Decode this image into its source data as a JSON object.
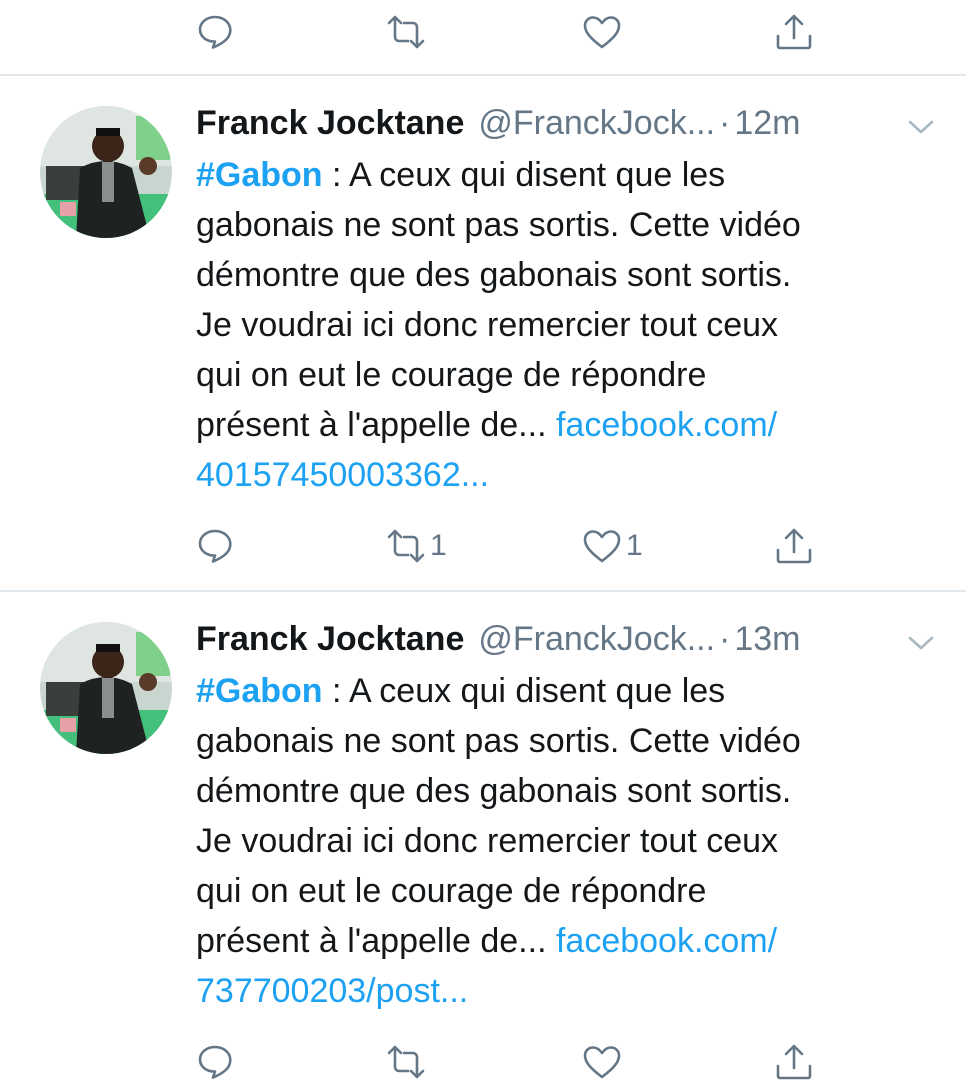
{
  "top_actions": {
    "reply_icon": "reply-icon",
    "retweet_icon": "retweet-icon",
    "like_icon": "like-icon",
    "share_icon": "share-icon"
  },
  "tweets": [
    {
      "name": "Franck Jocktane",
      "handle": "@FranckJock...",
      "separator": "·",
      "time": "12m",
      "hashtag": "#Gabon",
      "line1_rest": " : A ceux qui disent que les",
      "line2": "gabonais ne sont pas sortis. Cette vidéo",
      "line3": "démontre que des gabonais sont sortis.",
      "line4": "Je voudrai ici donc remercier tout ceux",
      "line5": "qui on eut le courage de répondre",
      "line6_text": "présent à l'appelle de... ",
      "line6_link": "facebook.com/",
      "line7_link": "40157450003362...",
      "retweet_count": "1",
      "like_count": "1"
    },
    {
      "name": "Franck Jocktane",
      "handle": "@FranckJock...",
      "separator": "·",
      "time": "13m",
      "hashtag": "#Gabon",
      "line1_rest": " : A ceux qui disent que les",
      "line2": "gabonais ne sont pas sortis. Cette vidéo",
      "line3": "démontre que des gabonais sont sortis.",
      "line4": "Je voudrai ici donc remercier tout ceux",
      "line5": "qui on eut le courage de répondre",
      "line6_text": "présent à l'appelle de... ",
      "line6_link": "facebook.com/",
      "line7_link": "737700203/post...",
      "retweet_count": "",
      "like_count": ""
    }
  ],
  "colors": {
    "link": "#1da1f2",
    "secondary": "#657786",
    "divider": "#e1e8ed",
    "text": "#14171a"
  }
}
